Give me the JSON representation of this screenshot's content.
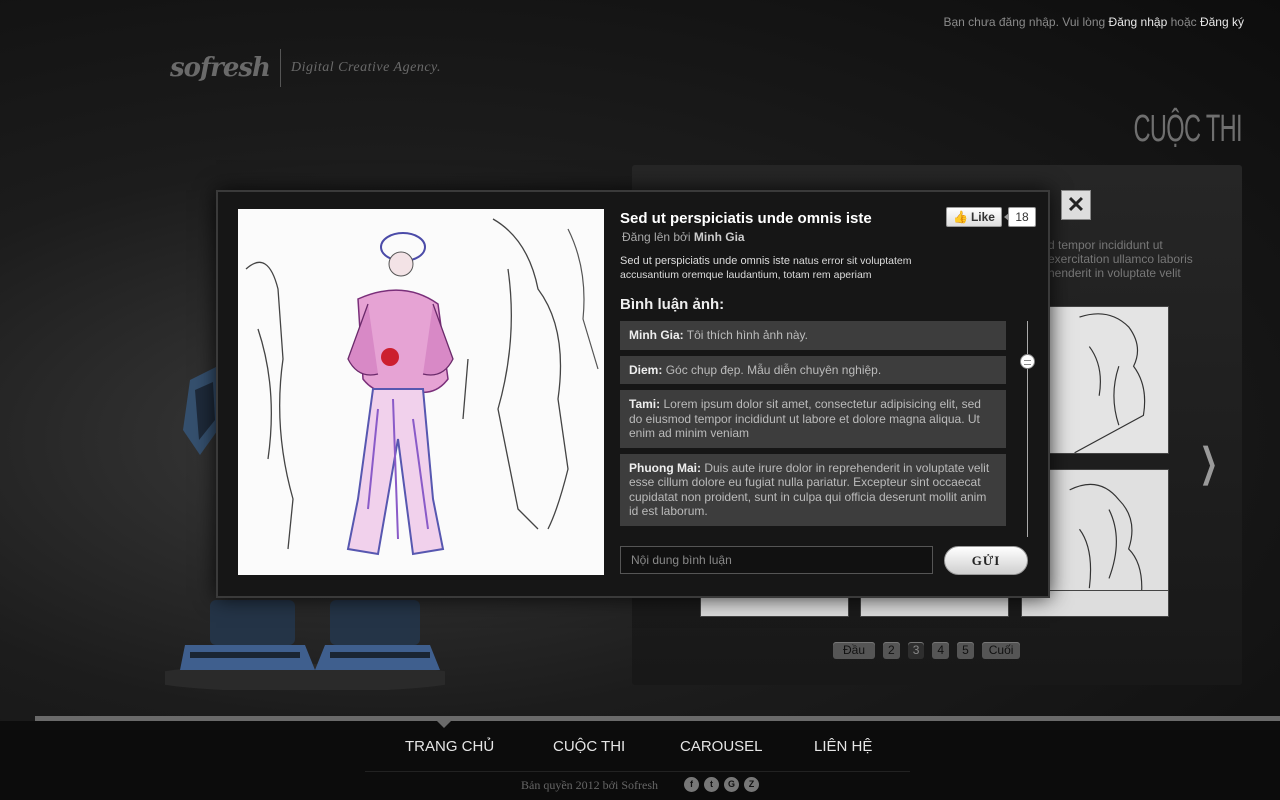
{
  "topbar": {
    "prefix": "Bạn chưa đăng nhập. Vui lòng",
    "login": "Đăng nhập",
    "or": "hoặc",
    "register": "Đăng ký"
  },
  "brand": {
    "logo": "sofresh",
    "tagline": "Digital Creative Agency."
  },
  "section_title": "CUỘC THI",
  "background": {
    "text": "d tempor incididunt ut exercitation ullamco laboris henderit in voluptate velit"
  },
  "pagination": {
    "first": "Đầu",
    "pages": [
      "2",
      "3",
      "4",
      "5"
    ],
    "active": "3",
    "last": "Cuối"
  },
  "modal": {
    "title": "Sed ut perspiciatis unde omnis iste",
    "posted_by_prefix": "Đăng lên bởi",
    "posted_by_name": "Minh Gia",
    "description_lead": "Sed ut perspiciatis unde omnis iste",
    "description_rest": "natus error sit voluptatem accusantium oremque laudantium, totam rem aperiam",
    "like_label": "Like",
    "like_count": "18",
    "comments_heading": "Bình luận ảnh:",
    "comments": [
      {
        "author": "Minh Gia:",
        "text": "Tôi thích hình ảnh này."
      },
      {
        "author": "Diem:",
        "text": "Góc chụp đẹp. Mẫu diễn chuyên nghiệp."
      },
      {
        "author": "Tami:",
        "text": "Lorem ipsum dolor sit amet, consectetur adipisicing elit, sed do eiusmod tempor incididunt ut labore et dolore magna aliqua. Ut enim ad minim veniam"
      },
      {
        "author": "Phuong Mai:",
        "text": "Duis aute irure dolor in reprehenderit in voluptate velit esse cillum dolore eu fugiat nulla pariatur. Excepteur sint occaecat cupidatat non proident, sunt in culpa qui officia deserunt mollit anim id est laborum."
      }
    ],
    "comment_placeholder": "Nội dung bình luận",
    "send_label": "GỬI",
    "close_label": "✕"
  },
  "nav": {
    "items": [
      "TRANG CHỦ",
      "CUỘC THI",
      "CAROUSEL",
      "LIÊN HỆ"
    ]
  },
  "footer": {
    "copyright": "Bản quyền 2012 bởi Sofresh",
    "socials": [
      "f",
      "t",
      "G",
      "Z"
    ]
  },
  "icons": {
    "close": "close-icon",
    "like": "thumbs-up-icon",
    "next": "chevron-right-icon",
    "socials": [
      "facebook-icon",
      "twitter-icon",
      "google-icon",
      "zing-icon"
    ]
  }
}
